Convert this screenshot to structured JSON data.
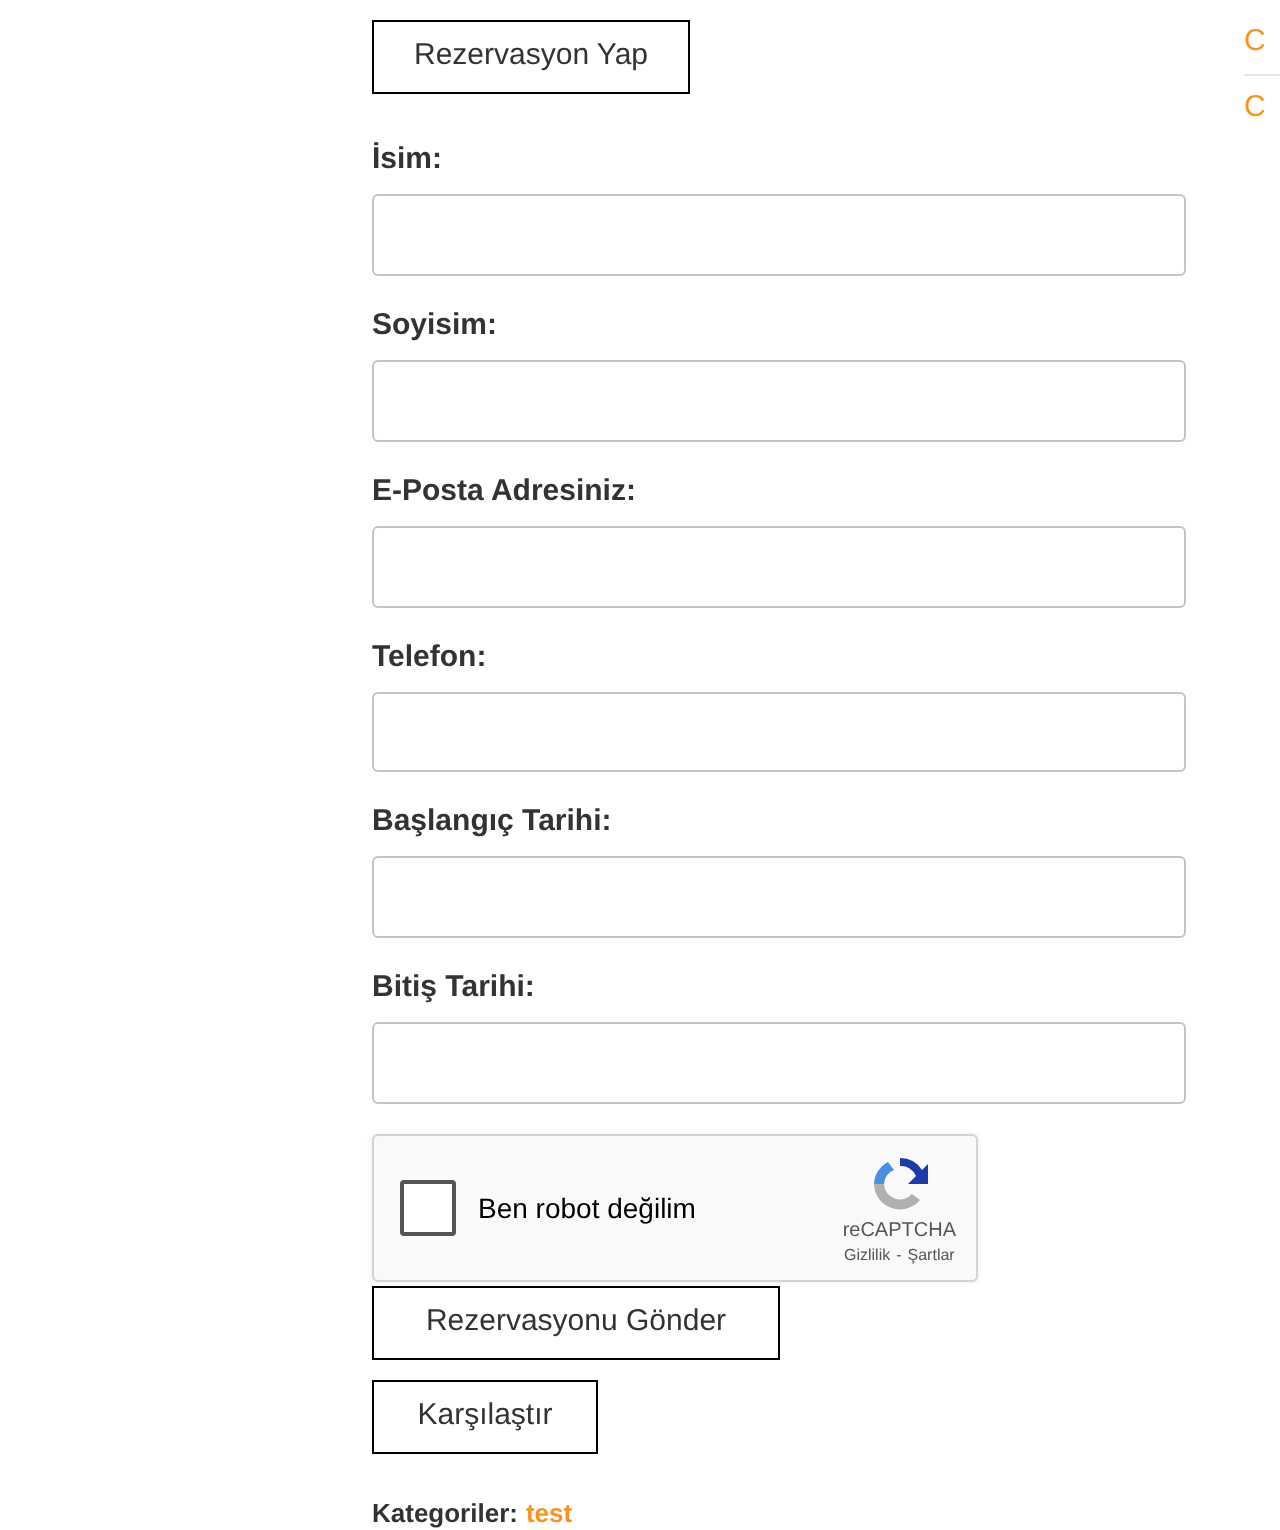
{
  "reserve_button": "Rezervasyon Yap",
  "fields": [
    {
      "label": "İsim:"
    },
    {
      "label": "Soyisim:"
    },
    {
      "label": "E-Posta Adresiniz:"
    },
    {
      "label": "Telefon:"
    },
    {
      "label": "Başlangıç Tarihi:"
    },
    {
      "label": "Bitiş Tarihi:"
    }
  ],
  "captcha": {
    "label": "Ben robot değilim",
    "checked": false,
    "brand": "reCAPTCHA",
    "privacy": "Gizlilik",
    "separator": "-",
    "terms": "Şartlar"
  },
  "submit_button": "Rezervasyonu Gönder",
  "compare_button": "Karşılaştır",
  "categories": {
    "label": "Kategoriler:",
    "value": "test"
  },
  "sidebar": {
    "links": [
      "C",
      "C"
    ]
  }
}
